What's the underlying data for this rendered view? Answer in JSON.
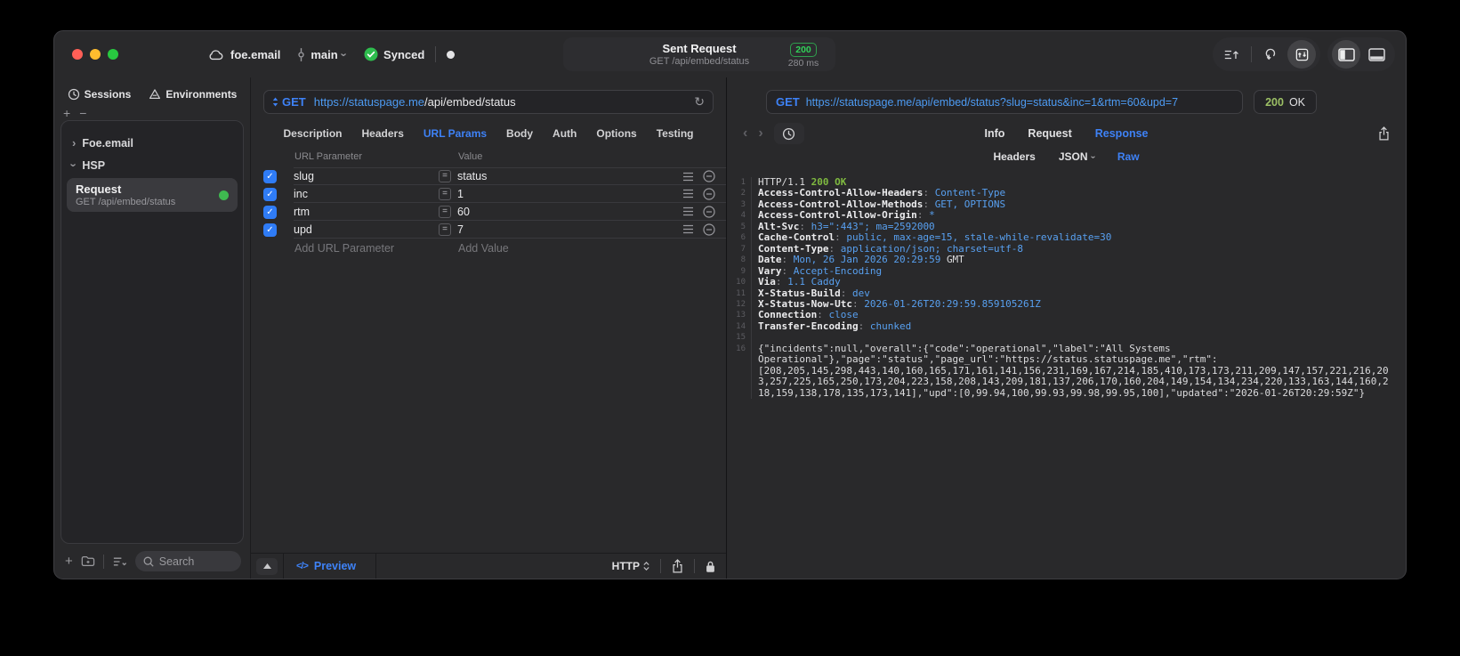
{
  "titlebar": {
    "project": "foe.email",
    "branch": "main",
    "sync_status": "Synced",
    "request": {
      "title": "Sent Request",
      "subtitle": "GET /api/embed/status",
      "status_code": "200",
      "duration": "280 ms"
    }
  },
  "sidebar": {
    "tabs": [
      {
        "label": "Sessions",
        "icon": "history-icon"
      },
      {
        "label": "Environments",
        "icon": "environments-icon"
      }
    ],
    "tree": [
      {
        "label": "Foe.email",
        "expanded": false
      },
      {
        "label": "HSP",
        "expanded": true
      }
    ],
    "request_item": {
      "title": "Request",
      "subtitle": "GET /api/embed/status",
      "status": "green"
    },
    "search_placeholder": "Search"
  },
  "request_pane": {
    "method": "GET",
    "url_host": "https://statuspage.me",
    "url_path": "/api/embed/status",
    "tabs": [
      "Description",
      "Headers",
      "URL Params",
      "Body",
      "Auth",
      "Options",
      "Testing"
    ],
    "active_tab": "URL Params",
    "params_table": {
      "columns": [
        "URL Parameter",
        "Value"
      ],
      "rows": [
        {
          "name": "slug",
          "value": "status",
          "enabled": true
        },
        {
          "name": "inc",
          "value": "1",
          "enabled": true
        },
        {
          "name": "rtm",
          "value": "60",
          "enabled": true
        },
        {
          "name": "upd",
          "value": "7",
          "enabled": true
        }
      ],
      "add_parameter_placeholder": "Add URL Parameter",
      "add_value_placeholder": "Add Value"
    },
    "footer": {
      "preview_label": "Preview",
      "protocol": "HTTP"
    }
  },
  "response_pane": {
    "method": "GET",
    "url": "https://statuspage.me/api/embed/status?slug=status&inc=1&rtm=60&upd=7",
    "status_code": "200",
    "status_text": "OK",
    "tabs": [
      "Info",
      "Request",
      "Response"
    ],
    "active_tab": "Response",
    "subtabs": [
      {
        "label": "Headers"
      },
      {
        "label": "JSON",
        "chevron": true
      },
      {
        "label": "Raw"
      }
    ],
    "active_subtab": "Raw",
    "body_lines": [
      {
        "n": 1,
        "parts": [
          [
            "HTTP/1.1 ",
            "p"
          ],
          [
            "200 OK",
            "g"
          ]
        ]
      },
      {
        "n": 2,
        "parts": [
          [
            "Access-Control-Allow-Headers",
            "n"
          ],
          [
            ": ",
            "d"
          ],
          [
            "Content-Type",
            "v"
          ]
        ]
      },
      {
        "n": 3,
        "parts": [
          [
            "Access-Control-Allow-Methods",
            "n"
          ],
          [
            ": ",
            "d"
          ],
          [
            "GET, OPTIONS",
            "v"
          ]
        ]
      },
      {
        "n": 4,
        "parts": [
          [
            "Access-Control-Allow-Origin",
            "n"
          ],
          [
            ": ",
            "d"
          ],
          [
            "*",
            "v"
          ]
        ]
      },
      {
        "n": 5,
        "parts": [
          [
            "Alt-Svc",
            "n"
          ],
          [
            ": ",
            "d"
          ],
          [
            "h3=\":443\"; ma=2592000",
            "v"
          ]
        ]
      },
      {
        "n": 6,
        "parts": [
          [
            "Cache-Control",
            "n"
          ],
          [
            ": ",
            "d"
          ],
          [
            "public, max-age=15, stale-while-revalidate=30",
            "v"
          ]
        ]
      },
      {
        "n": 7,
        "parts": [
          [
            "Content-Type",
            "n"
          ],
          [
            ": ",
            "d"
          ],
          [
            "application/json; charset=utf-8",
            "v"
          ]
        ]
      },
      {
        "n": 8,
        "parts": [
          [
            "Date",
            "n"
          ],
          [
            ": ",
            "d"
          ],
          [
            "Mon, 26 Jan 2026 20:29:59 ",
            "v"
          ],
          [
            "GMT",
            "p"
          ]
        ]
      },
      {
        "n": 9,
        "parts": [
          [
            "Vary",
            "n"
          ],
          [
            ": ",
            "d"
          ],
          [
            "Accept-Encoding",
            "v"
          ]
        ]
      },
      {
        "n": 10,
        "parts": [
          [
            "Via",
            "n"
          ],
          [
            ": ",
            "d"
          ],
          [
            "1.1 Caddy",
            "v"
          ]
        ]
      },
      {
        "n": 11,
        "parts": [
          [
            "X-Status-Build",
            "n"
          ],
          [
            ": ",
            "d"
          ],
          [
            "dev",
            "v"
          ]
        ]
      },
      {
        "n": 12,
        "parts": [
          [
            "X-Status-Now-Utc",
            "n"
          ],
          [
            ": ",
            "d"
          ],
          [
            "2026-01-26T20:29:59.859105261Z",
            "v"
          ]
        ]
      },
      {
        "n": 13,
        "parts": [
          [
            "Connection",
            "n"
          ],
          [
            ": ",
            "d"
          ],
          [
            "close",
            "v"
          ]
        ]
      },
      {
        "n": 14,
        "parts": [
          [
            "Transfer-Encoding",
            "n"
          ],
          [
            ": ",
            "d"
          ],
          [
            "chunked",
            "v"
          ]
        ]
      },
      {
        "n": 15,
        "parts": []
      },
      {
        "n": 16,
        "parts": [
          [
            "{\"incidents\":null,\"overall\":{\"code\":\"operational\",\"label\":\"All Systems Operational\"},\"page\":\"status\",\"page_url\":\"https://status.statuspage.me\",\"rtm\":[208,205,145,298,443,140,160,165,171,161,141,156,231,169,167,214,185,410,173,173,211,209,147,157,221,216,203,257,225,165,250,173,204,223,158,208,143,209,181,137,206,170,160,204,149,154,134,234,220,133,163,144,160,218,159,138,178,135,173,141],\"upd\":[0,99.94,100,99.93,99.98,99.95,100],\"updated\":\"2026-01-26T20:29:59Z\"}",
            "p"
          ]
        ]
      }
    ]
  },
  "colors": {
    "accent_blue": "#3e82f7",
    "value_blue": "#58a0f0",
    "badge_green": "#30d158",
    "body_green": "#7fba40",
    "checkbox_blue": "#2f7cf6",
    "status_dot_green": "#3fb950"
  }
}
